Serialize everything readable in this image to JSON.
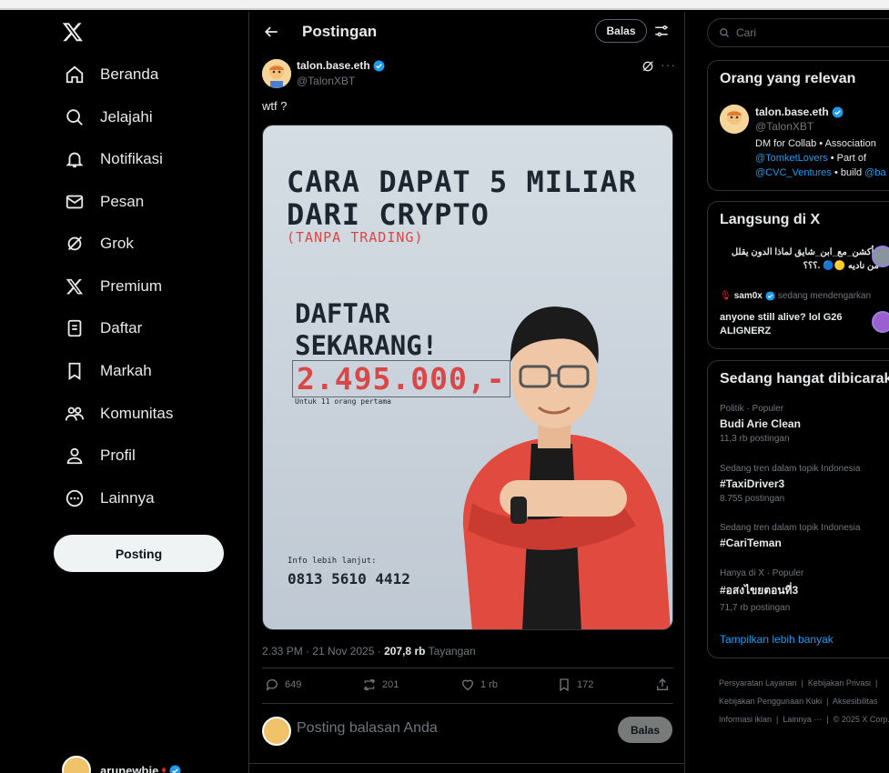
{
  "nav": {
    "items": [
      {
        "label": "Beranda",
        "icon": "home-icon"
      },
      {
        "label": "Jelajahi",
        "icon": "search-icon"
      },
      {
        "label": "Notifikasi",
        "icon": "bell-icon"
      },
      {
        "label": "Pesan",
        "icon": "envelope-icon"
      },
      {
        "label": "Grok",
        "icon": "grok-icon"
      },
      {
        "label": "Premium",
        "icon": "x-logo-icon"
      },
      {
        "label": "Daftar",
        "icon": "list-icon"
      },
      {
        "label": "Markah",
        "icon": "bookmark-icon"
      },
      {
        "label": "Komunitas",
        "icon": "people-icon"
      },
      {
        "label": "Profil",
        "icon": "person-icon"
      },
      {
        "label": "Lainnya",
        "icon": "more-circle-icon"
      }
    ],
    "post_button": "Posting",
    "account_name": "arunewbie",
    "account_more": "···"
  },
  "header": {
    "title": "Postingan",
    "reply_button": "Balas"
  },
  "post": {
    "author_name": "talon.base.eth",
    "author_handle": "@TalonXBT",
    "text": "wtf ?",
    "more": "···",
    "media": {
      "line1": "CARA DAPAT 5 MILIAR",
      "line2": "DARI CRYPTO",
      "sub": "(TANPA TRADING)",
      "cta1": "DAFTAR",
      "cta2": "SEKARANG!",
      "price": "2.495.000,-",
      "note": "Untuk 11 orang pertama",
      "info_label": "Info lebih lanjut:",
      "phone": "0813 5610 4412"
    },
    "time": "2.33 PM · 21 Nov 2025 · ",
    "views_count": "207,8 rb",
    "views_label": " Tayangan",
    "replies": "649",
    "reposts": "201",
    "likes": "1 rb",
    "bookmarks": "172"
  },
  "reply_box": {
    "placeholder": "Posting balasan Anda",
    "button": "Balas"
  },
  "search": {
    "placeholder": "Cari"
  },
  "relevant": {
    "title": "Orang yang relevan",
    "name": "talon.base.eth",
    "handle": "@TalonXBT",
    "bio1": "DM for Collab • Association",
    "bio2_link": "@TomketLovers",
    "bio2_text": " • Part of",
    "bio3_link": "@CVC_Ventures",
    "bio3_text": " • build ",
    "bio3_link2": "@ba"
  },
  "live": {
    "title": "Langsung di X",
    "item1": "#أكشن_مع_ابن_شايق لماذا الدون يقلل من ناديه 🟡🔵 .؟؟؟",
    "host": "sam0x",
    "host_status": "sedang mendengarkan",
    "item2": "anyone still alive? lol G26 ALIGNERZ"
  },
  "trends": {
    "title": "Sedang hangat dibicarakan",
    "items": [
      {
        "context": "Politik · Populer",
        "title": "Budi Arie Clean",
        "count": "11,3 rb postingan"
      },
      {
        "context": "Sedang tren dalam topik Indonesia",
        "title": "#TaxiDriver3",
        "count": "8.755 postingan"
      },
      {
        "context": "Sedang tren dalam topik Indonesia",
        "title": "#CariTeman",
        "count": ""
      },
      {
        "context": "Hanya di X · Populer",
        "title": "#อสงไขยตอนที่3",
        "count": "71,7 rb postingan"
      }
    ],
    "show_more": "Tampilkan lebih banyak"
  },
  "footer": {
    "links": [
      "Persyaratan Layanan",
      "Kebijakan Privasi",
      "Kebijakan Penggunaan Kuki",
      "Aksesibilitas",
      "Informasi iklan",
      "Lainnya ···",
      "© 2025 X Corp."
    ]
  },
  "colors": {
    "accent": "#1d9bf0",
    "price_red": "#d94848",
    "jacket_red": "#e04a3f"
  }
}
